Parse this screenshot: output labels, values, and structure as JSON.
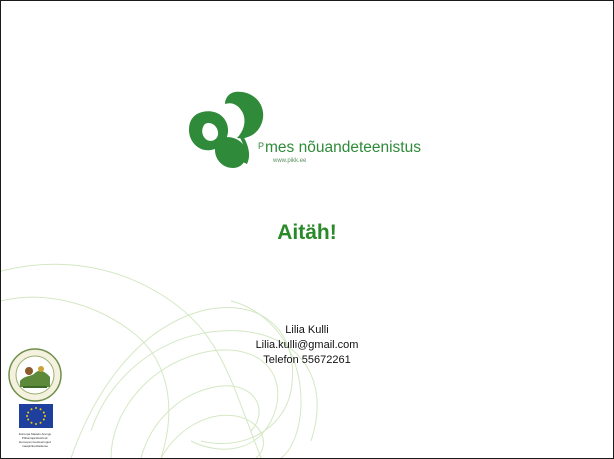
{
  "logo": {
    "prefix": "P",
    "name": "mes nõuandeteenistus",
    "url": "www.pikk.ee",
    "icon": "clover-leaf-icon"
  },
  "title": "Aitäh!",
  "contact": {
    "name": "Lilia Kulli",
    "email": "Lilia.kulli@gmail.com",
    "phone": "Telefon 55672261"
  },
  "footer": {
    "seal_icon": "round-seal-logo",
    "flag_icon": "eu-flag-icon",
    "eu_caption_lines": [
      "Euroopa Maaelu Arengu",
      "Põllumajandusfond:",
      "Euroopa investeeringud",
      "maapiirkondadesse"
    ]
  },
  "colors": {
    "brand_green": "#2f8a3a",
    "title_green": "#2a8a2a",
    "swirl": "#d4e8c4"
  }
}
